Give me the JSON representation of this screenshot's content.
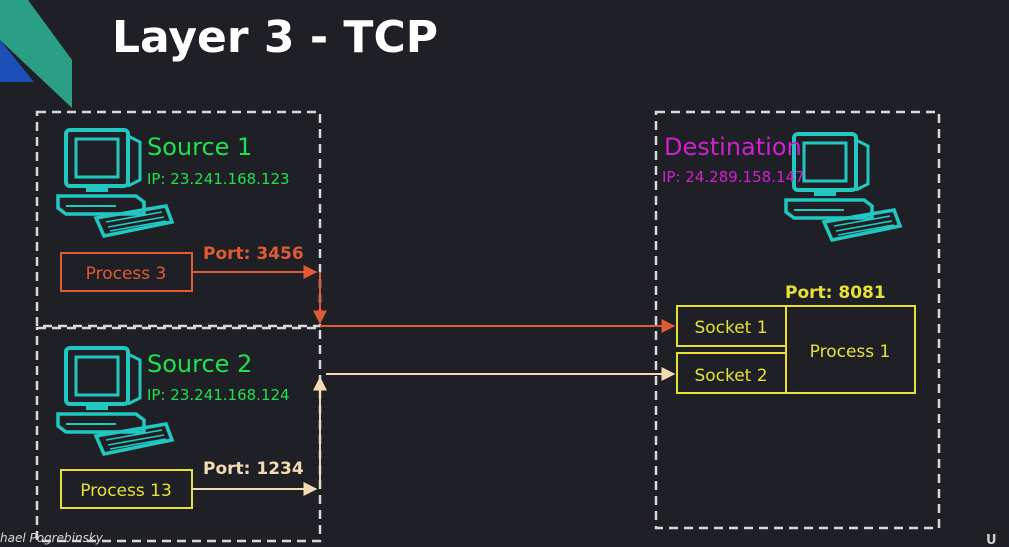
{
  "title": "Layer 3 - TCP",
  "source1": {
    "name": "Source 1",
    "ip": "IP: 23.241.168.123",
    "port_label": "Port: 3456",
    "process": "Process 3"
  },
  "source2": {
    "name": "Source 2",
    "ip": "IP: 23.241.168.124",
    "port_label": "Port: 1234",
    "process": "Process 13"
  },
  "destination": {
    "name": "Destination",
    "ip": "IP: 24.289.158.147",
    "port_label": "Port: 8081",
    "socket1": "Socket 1",
    "socket2": "Socket 2",
    "process": "Process 1"
  },
  "footer": {
    "author": "hael Pogrebinsky",
    "logo_text": "U"
  },
  "colors": {
    "background": "#1e2026",
    "title": "#ffffff",
    "source": "#1fe050",
    "destination": "#d21fd0",
    "computer": "#22c7c2",
    "orange": "#e05a33",
    "beige": "#f2dbb0",
    "yellow": "#e8e03a",
    "dashed": "#d8d8d8"
  },
  "icons": [
    "computer-icon",
    "logo-shape"
  ]
}
